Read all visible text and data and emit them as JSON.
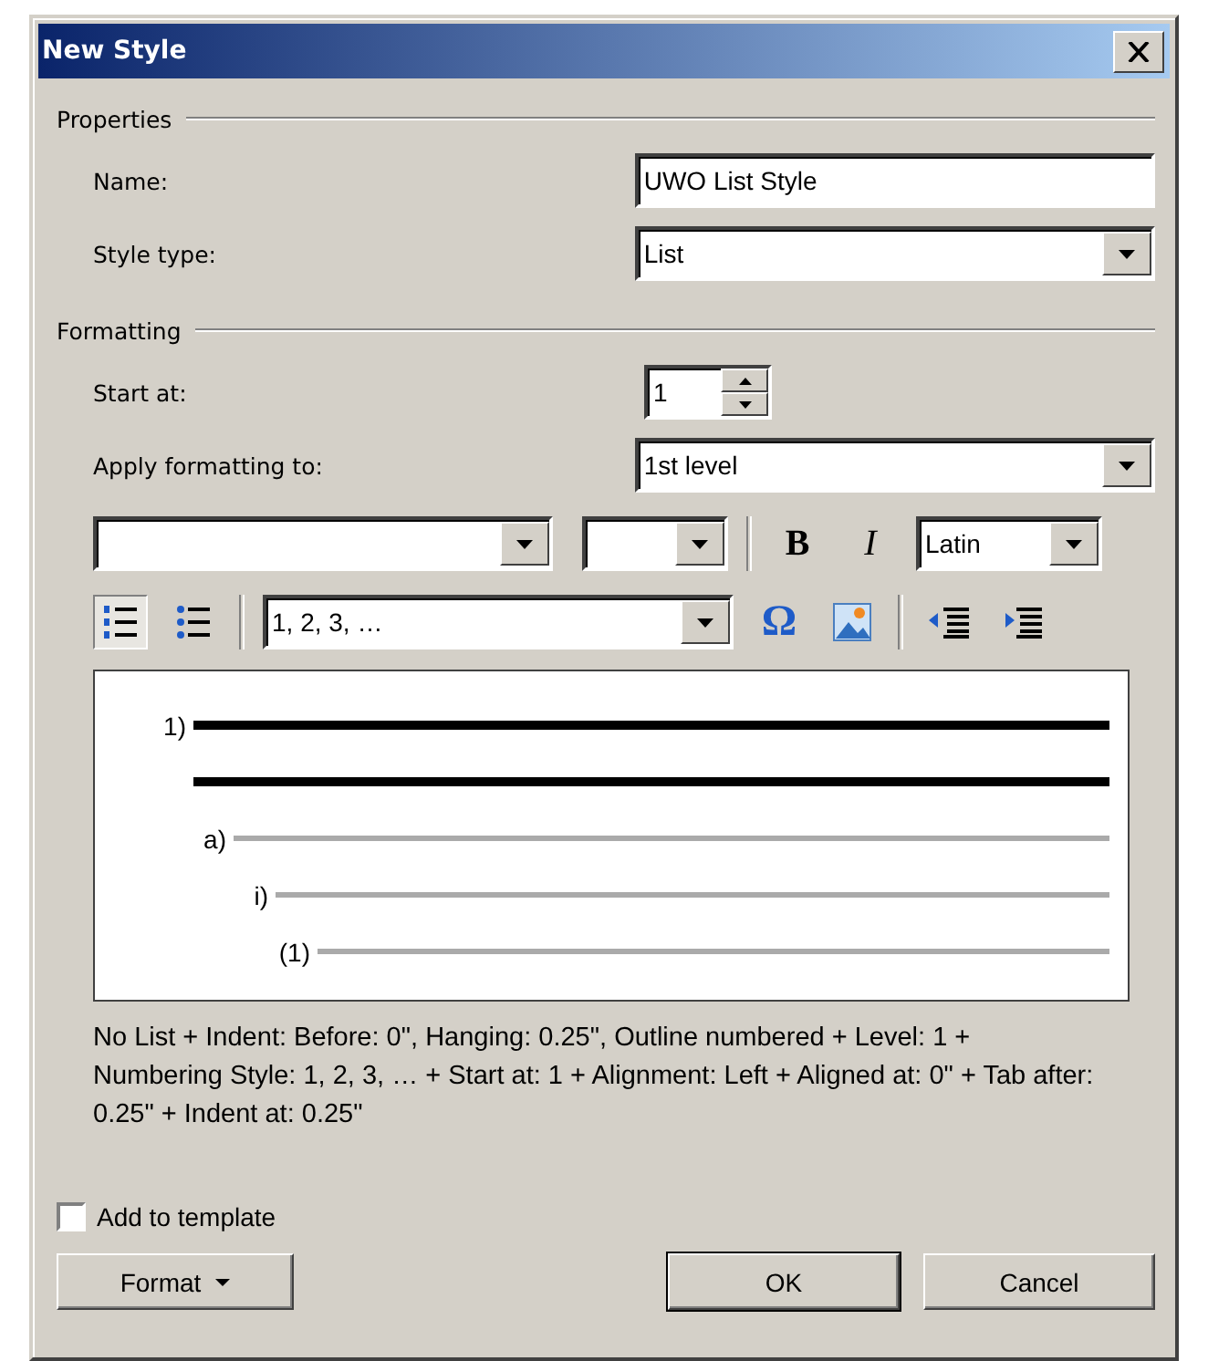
{
  "window": {
    "title": "New Style"
  },
  "properties": {
    "heading": "Properties",
    "name_label": "Name:",
    "name_value": "UWO List Style",
    "style_type_label": "Style type:",
    "style_type_value": "List"
  },
  "formatting": {
    "heading": "Formatting",
    "start_label": "Start at:",
    "start_value": "1",
    "apply_label": "Apply formatting to:",
    "apply_value": "1st level",
    "script_value": "Latin",
    "font_tools": [
      {
        "kind": "bold",
        "label": "B"
      },
      {
        "kind": "italic",
        "label": "I"
      }
    ],
    "list_tools": [
      {
        "kind": "numbered",
        "selected": true
      },
      {
        "kind": "bulleted",
        "selected": false
      }
    ],
    "numbering_style": "1, 2, 3, …",
    "insert_tools": [
      {
        "kind": "symbol",
        "label": "Ω"
      },
      {
        "kind": "picture"
      }
    ],
    "indent_tools": [
      {
        "kind": "decrease"
      },
      {
        "kind": "increase"
      }
    ]
  },
  "preview": {
    "levels": [
      {
        "marker": "1)",
        "selected": true,
        "wrapped": true,
        "children": [
          {
            "marker": "a)",
            "selected": false,
            "wrapped": false,
            "children": [
              {
                "marker": "i)",
                "selected": false,
                "wrapped": false,
                "children": [
                  {
                    "marker": "(1)",
                    "selected": false,
                    "wrapped": false
                  }
                ]
              }
            ]
          }
        ]
      }
    ]
  },
  "description": "No List + Indent: Before:  0\", Hanging:  0.25\", Outline numbered + Level: 1 + Numbering Style: 1, 2, 3, … + Start at: 1 + Alignment: Left + Aligned at:  0\" + Tab after:  0.25\" + Indent at:  0.25\"",
  "add_to_template": {
    "label": "Add to template",
    "checked": false
  },
  "buttons": [
    {
      "kind": "menu",
      "label": "Format"
    },
    {
      "kind": "plain",
      "label": "OK"
    },
    {
      "kind": "plain",
      "label": "Cancel"
    }
  ]
}
